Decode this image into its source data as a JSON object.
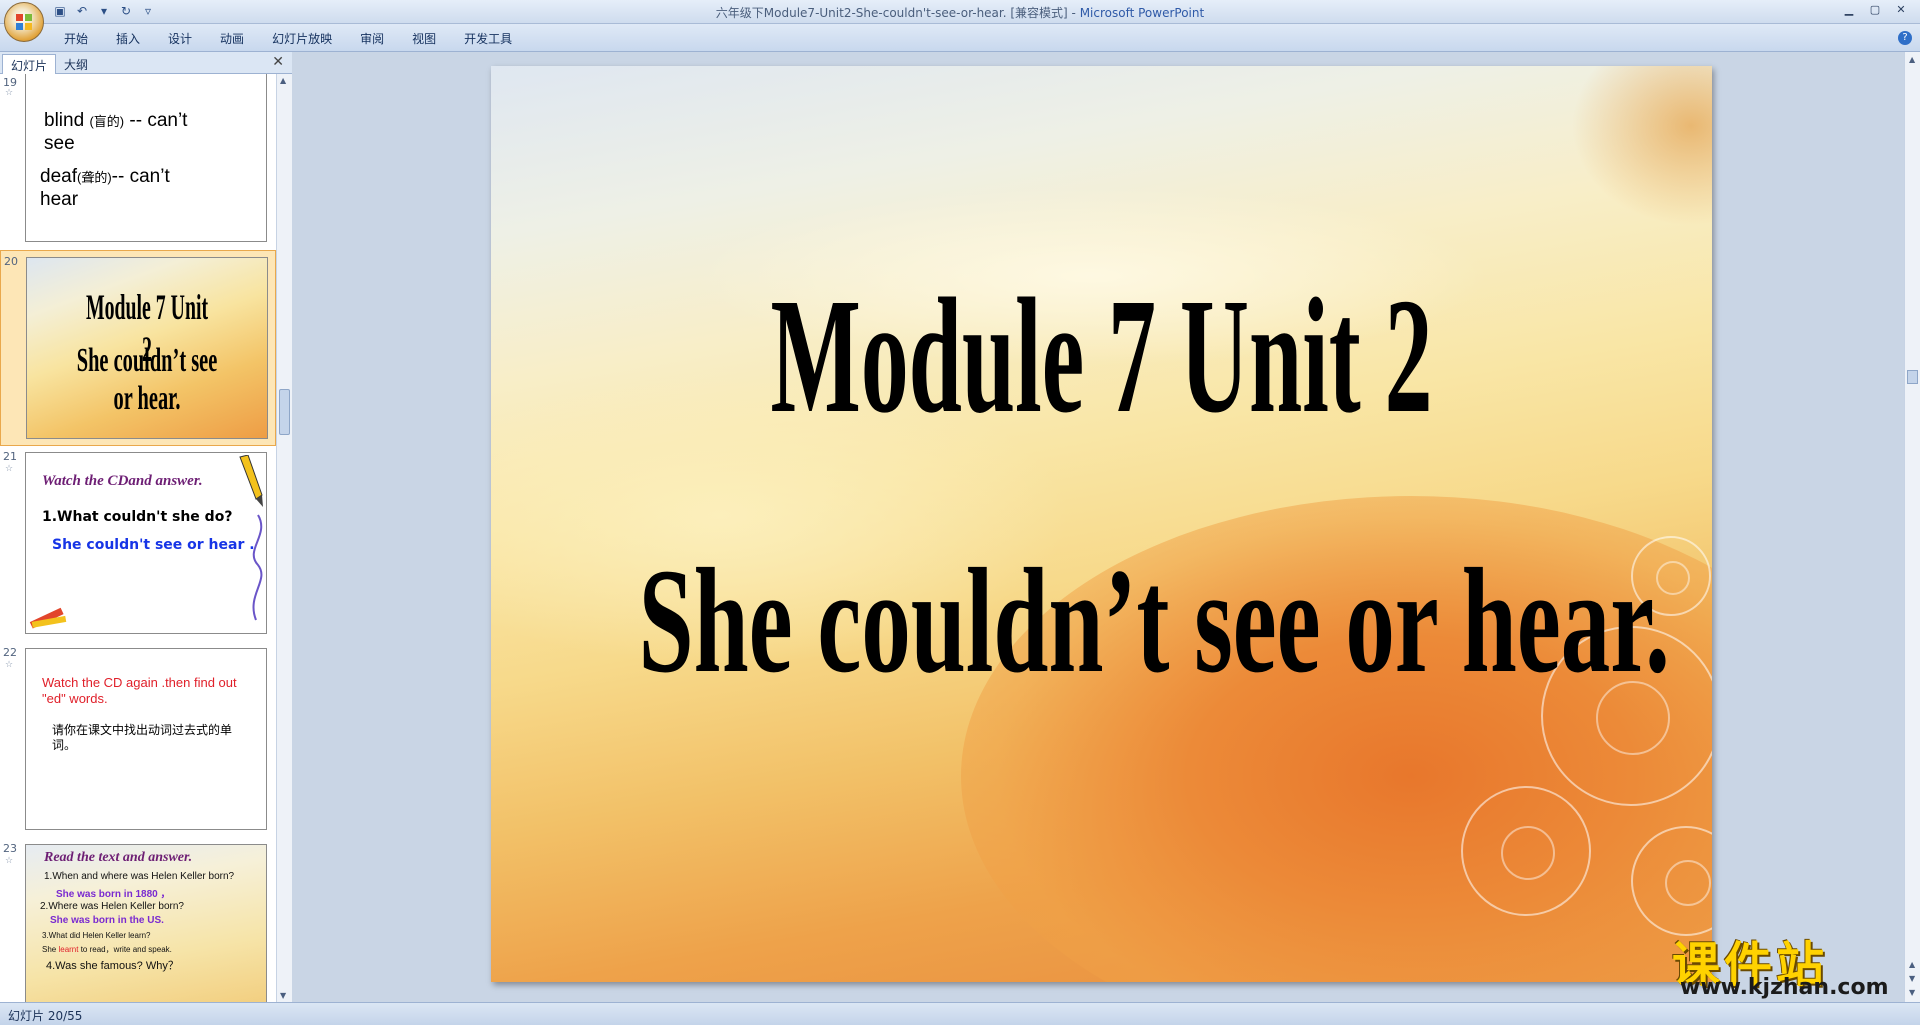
{
  "titlebar": {
    "doc_title": "六年级下Module7-Unit2-She-couldn't-see-or-hear. [兼容模式] - ",
    "app_name": "Microsoft PowerPoint"
  },
  "ribbon": {
    "tabs": [
      "开始",
      "插入",
      "设计",
      "动画",
      "幻灯片放映",
      "审阅",
      "视图",
      "开发工具"
    ]
  },
  "left_pane": {
    "tabs": [
      "幻灯片",
      "大纲"
    ],
    "close_label": "✕"
  },
  "thumbnails": [
    {
      "number": "19",
      "lines": [
        "blind",
        "(盲的)",
        " --  can’t",
        "see",
        "deaf",
        "(聋的)",
        "-- can’t",
        "hear"
      ]
    },
    {
      "number": "20",
      "line1": "Module 7 Unit 2",
      "line2": "She couldn’t see or hear."
    },
    {
      "number": "21",
      "heading": "Watch the CDand answer.",
      "question": "1.What couldn't she do?",
      "answer": "She couldn't see or hear ."
    },
    {
      "number": "22",
      "red_text": "Watch the CD again .then find out \"ed\" words.",
      "black_text": "请你在课文中找出动词过去式的单词。"
    },
    {
      "number": "23",
      "heading": "Read the text and answer.",
      "q1": "1.When and where was Helen Keller born?",
      "a1": "She was born in 1880 ，",
      "q2": "2.Where was Helen Keller born?",
      "a2": "She was born in the US.",
      "q3": "3.What did Helen Keller learn?",
      "a3_pre": "She ",
      "a3_verb": "learnt",
      "a3_post": " to read，write and speak.",
      "q4": "4.Was she famous? Why？"
    }
  ],
  "slide": {
    "line1": "Module 7 Unit 2",
    "line2": "She couldn’t see or hear."
  },
  "statusbar": {
    "text": "幻灯片 20/55"
  },
  "watermark": {
    "cn": "课件站",
    "url": "www.kjzhan.com"
  }
}
